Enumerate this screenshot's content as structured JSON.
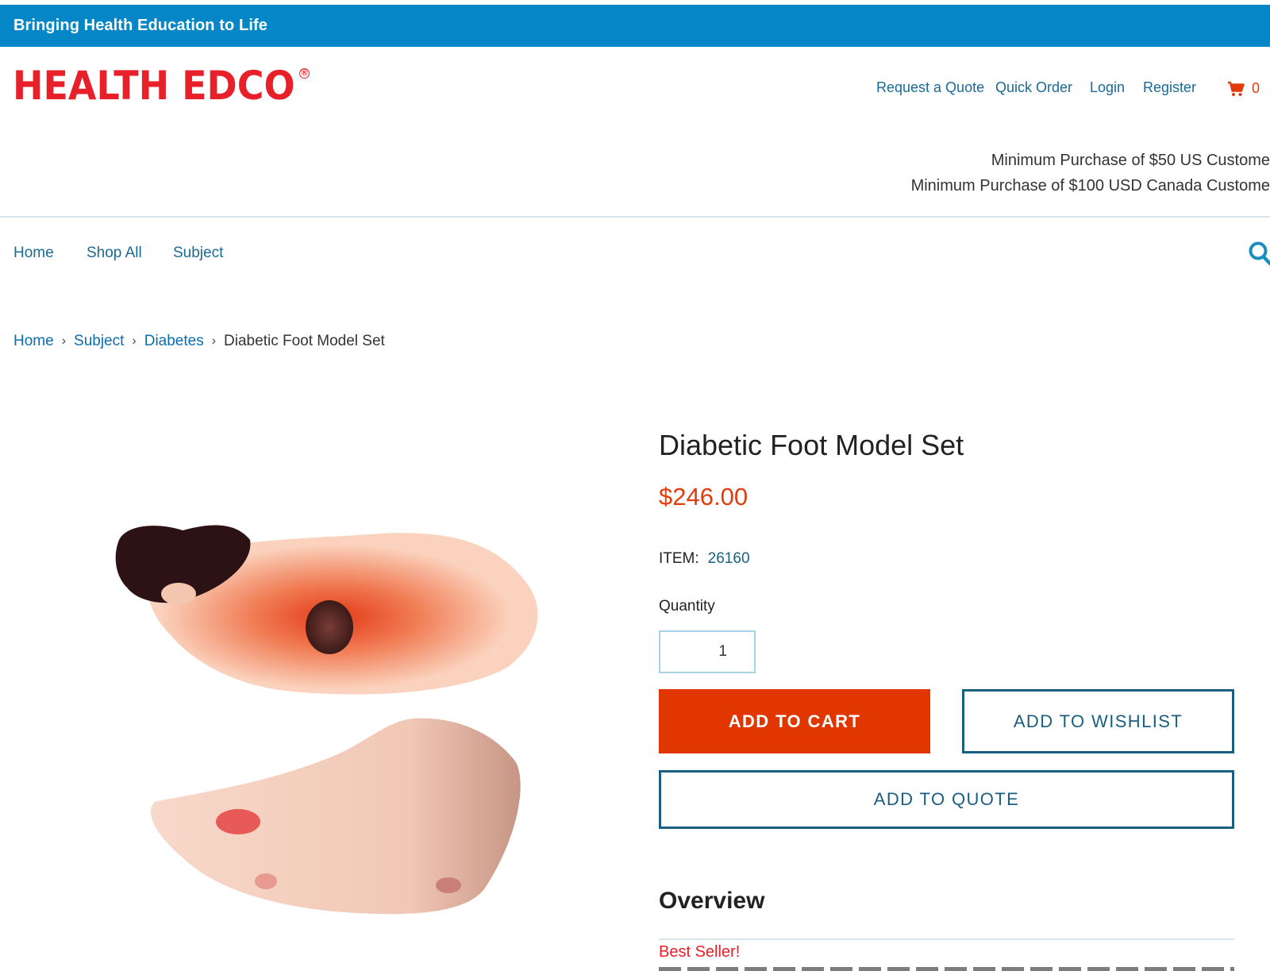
{
  "banner": {
    "text": "Bringing Health Education to Life"
  },
  "header": {
    "logo_text": "HEALTH EDCO",
    "logo_mark": "®",
    "utility_nav": [
      "Request a Quote",
      "Quick Order",
      "Login",
      "Register"
    ],
    "cart_icon": "cart-icon",
    "cart_count": "0",
    "min_purchase": [
      "Minimum Purchase of $50 US Custome",
      "Minimum Purchase of $100 USD Canada Custome"
    ]
  },
  "main_nav": {
    "items": [
      "Home",
      "Shop All",
      "Subject"
    ],
    "search_icon": "search-icon"
  },
  "breadcrumb": {
    "items": [
      "Home",
      "Subject",
      "Diabetes"
    ],
    "current": "Diabetic Foot Model Set"
  },
  "product": {
    "title": "Diabetic Foot Model Set",
    "price": "$246.00",
    "item_label": "ITEM:",
    "item_number": "26160",
    "quantity_label": "Quantity",
    "quantity_value": "1",
    "add_to_cart": "ADD TO CART",
    "add_to_wishlist": "ADD TO WISHLIST",
    "add_to_quote": "ADD TO QUOTE",
    "overview_heading": "Overview",
    "badge": "Best Seller!"
  },
  "colors": {
    "banner": "#0586c6",
    "brand_red": "#e8202a",
    "price": "#e23b0c",
    "link": "#1a6a95",
    "cart_button": "#e23600"
  }
}
